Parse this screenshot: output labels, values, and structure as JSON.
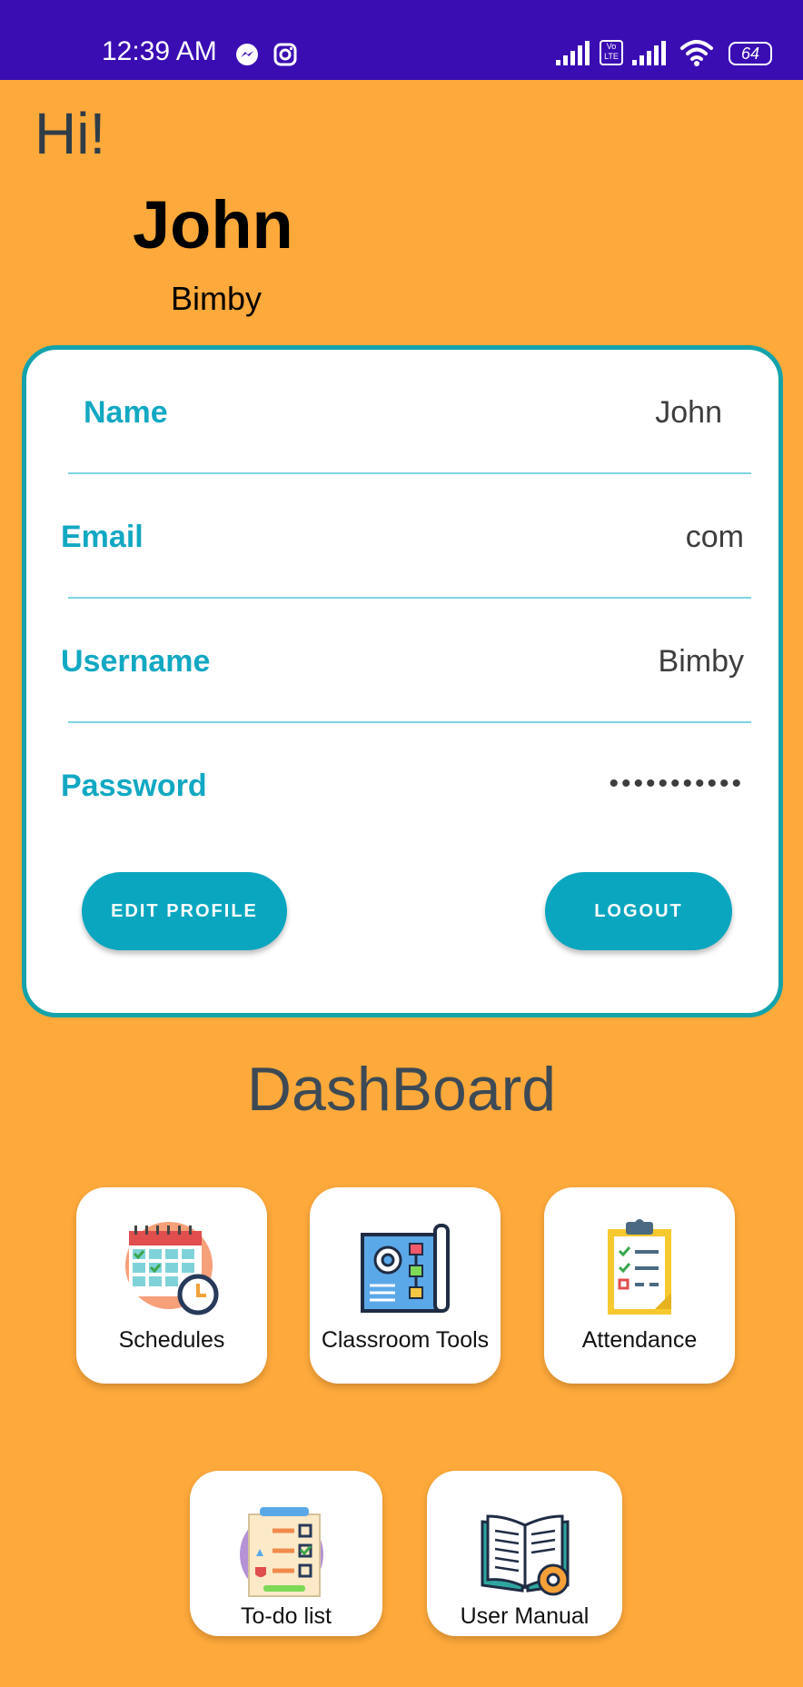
{
  "status_bar": {
    "time": "12:39 AM",
    "battery": "64",
    "volte": "Vo LTE",
    "icons": [
      "messenger-icon",
      "instagram-icon",
      "signal-icon",
      "volte-icon",
      "signal-icon",
      "wifi-icon",
      "battery-icon"
    ]
  },
  "header": {
    "greeting": "Hi!",
    "first_name": "John",
    "last_name": "Bimby"
  },
  "profile": {
    "fields": [
      {
        "label": "Name",
        "value": "John"
      },
      {
        "label": "Email",
        "value": "com"
      },
      {
        "label": "Username",
        "value": "Bimby"
      },
      {
        "label": "Password",
        "value": "•••••••••••"
      }
    ],
    "edit_label": "EDIT PROFILE",
    "logout_label": "LOGOUT"
  },
  "dashboard": {
    "title": "DashBoard",
    "tiles": [
      {
        "label": "Schedules",
        "icon": "calendar-clock-icon"
      },
      {
        "label": "Classroom Tools",
        "icon": "blueprint-gear-icon"
      },
      {
        "label": "Attendance",
        "icon": "clipboard-checklist-icon"
      },
      {
        "label": "To-do list",
        "icon": "checklist-icon"
      },
      {
        "label": "User Manual",
        "icon": "book-gear-icon"
      }
    ]
  },
  "colors": {
    "background": "#FEA93B",
    "status_bar": "#3A0DB3",
    "accent": "#0AA6BF",
    "card_border": "#14A3AB"
  }
}
